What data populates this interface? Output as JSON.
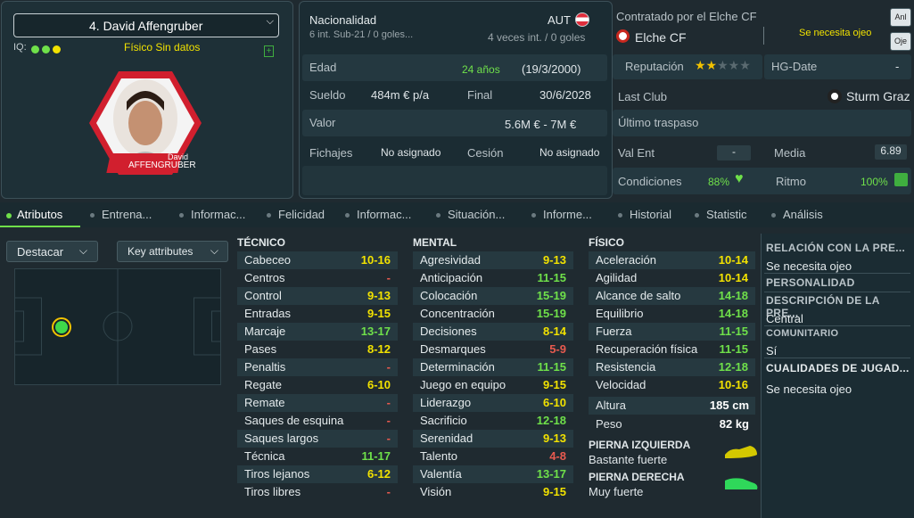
{
  "player": {
    "name": "4. David Affengruber",
    "iq_label": "IQ:",
    "fitness": "Físico",
    "fitness_status": "Sin datos",
    "card_first": "David",
    "card_last": "AFFENGRUBER"
  },
  "info": {
    "nationality_label": "Nacionalidad",
    "nationality": "AUT",
    "u21": "6 int. Sub-21 / 0 goles...",
    "intl": "4 veces int. / 0 goles",
    "contract_label": "Contratado por el Elche CF",
    "club": "Elche CF",
    "scout_note": "Se necesita ojeo",
    "age_label": "Edad",
    "age": "24 años",
    "dob": "(19/3/2000)",
    "rep_label": "Reputación",
    "hg_label": "HG-Date",
    "hg_value": "-",
    "wage_label": "Sueldo",
    "wage": "484m € p/a",
    "end_label": "Final",
    "end": "30/6/2028",
    "last_club_label": "Last Club",
    "last_club": "Sturm Graz",
    "value_label": "Valor",
    "value": "5.6M € - 7M €",
    "transfer_label": "Último traspaso",
    "transfer": "",
    "signings_label": "Fichajes",
    "signings": "No asignado",
    "loan_label": "Cesión",
    "loan": "No asignado",
    "valent_label": "Val Ent",
    "valent": "-",
    "media_label": "Media",
    "media": "6.89",
    "cond_label": "Condiciones",
    "cond": "88%",
    "ritmo_label": "Ritmo",
    "ritmo": "100%",
    "reputation_stars": 2
  },
  "side_buttons": [
    "Anl",
    "Oje"
  ],
  "tabs": [
    "Atributos",
    "Entrena...",
    "Informac...",
    "Felicidad",
    "Informac...",
    "Situación...",
    "Informe...",
    "Historial",
    "Statistic",
    "Análisis"
  ],
  "controls": {
    "highlight": "Destacar",
    "key": "Key attributes"
  },
  "tecnico": {
    "title": "TÉCNICO",
    "items": [
      [
        "Cabeceo",
        "10-16",
        "y"
      ],
      [
        "Centros",
        "-",
        "r"
      ],
      [
        "Control",
        "9-13",
        "y"
      ],
      [
        "Entradas",
        "9-15",
        "y"
      ],
      [
        "Marcaje",
        "13-17",
        "g"
      ],
      [
        "Pases",
        "8-12",
        "y"
      ],
      [
        "Penaltis",
        "-",
        "r"
      ],
      [
        "Regate",
        "6-10",
        "y"
      ],
      [
        "Remate",
        "-",
        "r"
      ],
      [
        "Saques de esquina",
        "-",
        "r"
      ],
      [
        "Saques largos",
        "-",
        "r"
      ],
      [
        "Técnica",
        "11-17",
        "g"
      ],
      [
        "Tiros lejanos",
        "6-12",
        "y"
      ],
      [
        "Tiros libres",
        "-",
        "r"
      ]
    ]
  },
  "mental": {
    "title": "MENTAL",
    "items": [
      [
        "Agresividad",
        "9-13",
        "y"
      ],
      [
        "Anticipación",
        "11-15",
        "g"
      ],
      [
        "Colocación",
        "15-19",
        "g"
      ],
      [
        "Concentración",
        "15-19",
        "g"
      ],
      [
        "Decisiones",
        "8-14",
        "y"
      ],
      [
        "Desmarques",
        "5-9",
        "r"
      ],
      [
        "Determinación",
        "11-15",
        "g"
      ],
      [
        "Juego en equipo",
        "9-15",
        "y"
      ],
      [
        "Liderazgo",
        "6-10",
        "y"
      ],
      [
        "Sacrificio",
        "12-18",
        "g"
      ],
      [
        "Serenidad",
        "9-13",
        "y"
      ],
      [
        "Talento",
        "4-8",
        "r"
      ],
      [
        "Valentía",
        "13-17",
        "g"
      ],
      [
        "Visión",
        "9-15",
        "y"
      ]
    ]
  },
  "fisico": {
    "title": "FÍSICO",
    "items": [
      [
        "Aceleración",
        "10-14",
        "y"
      ],
      [
        "Agilidad",
        "10-14",
        "y"
      ],
      [
        "Alcance de salto",
        "14-18",
        "g"
      ],
      [
        "Equilibrio",
        "14-18",
        "g"
      ],
      [
        "Fuerza",
        "11-15",
        "g"
      ],
      [
        "Recuperación física",
        "11-15",
        "g"
      ],
      [
        "Resistencia",
        "12-18",
        "g"
      ],
      [
        "Velocidad",
        "10-16",
        "y"
      ]
    ]
  },
  "physical": {
    "height_label": "Altura",
    "height": "185 cm",
    "weight_label": "Peso",
    "weight": "82 kg",
    "left_label": "PIERNA IZQUIERDA",
    "left": "Bastante fuerte",
    "right_label": "PIERNA DERECHA",
    "right": "Muy fuerte"
  },
  "right_panel": {
    "h1": "RELACIÓN CON LA PRE...",
    "v1": "Se necesita ojeo",
    "h2": "PERSONALIDAD",
    "h3": "DESCRIPCIÓN DE LA PRE...",
    "v3": "Central",
    "h4": "COMUNITARIO",
    "v4": "Sí",
    "h5": "CUALIDADES DE JUGAD...",
    "v5": "Se necesita ojeo"
  },
  "colors": {
    "yellow": "#f2e200",
    "green": "#6fe04a",
    "red": "#e85a4f"
  }
}
